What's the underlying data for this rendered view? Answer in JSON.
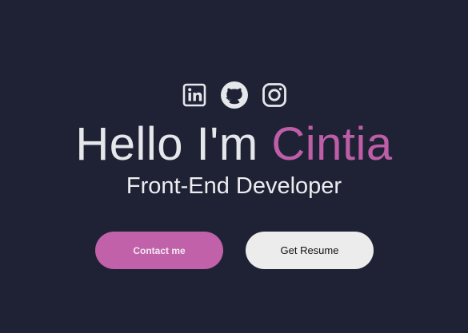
{
  "hero": {
    "socials": [
      {
        "icon": "linkedin-icon"
      },
      {
        "icon": "github-icon"
      },
      {
        "icon": "instagram-icon"
      }
    ],
    "greeting": "Hello I'm",
    "name": "Cintia",
    "role": "Front-End Developer",
    "contact_label": "Contact me",
    "resume_label": "Get Resume"
  },
  "colors": {
    "background": "#1f2235",
    "accent": "#bd5ea7",
    "text": "#e6e7ea",
    "resume_button": "#ececec"
  }
}
